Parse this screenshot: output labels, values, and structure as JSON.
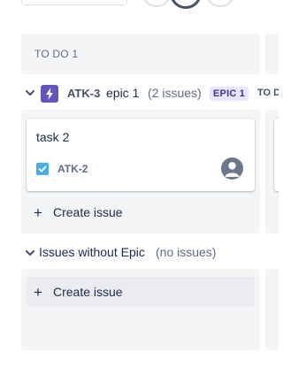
{
  "column": {
    "header": "TO DO 1"
  },
  "epic_swimlane": {
    "key": "ATK-3",
    "name": "epic 1",
    "count": "(2 issues)",
    "lozenge": "EPIC 1",
    "overflow_text": "TO D"
  },
  "card": {
    "title": "task 2",
    "key": "ATK-2",
    "issue_type_icon": "checkbox-icon",
    "assignee_icon": "avatar-icon"
  },
  "create_issue": {
    "label": "Create issue"
  },
  "no_epic_swimlane": {
    "label": "Issues without Epic",
    "count": "(no issues)"
  },
  "colors": {
    "column_bg": "#f4f5f7",
    "epic_purple": "#6554c0",
    "lozenge_bg": "#eae6ff",
    "lozenge_text": "#403294",
    "task_blue": "#4bade8"
  }
}
